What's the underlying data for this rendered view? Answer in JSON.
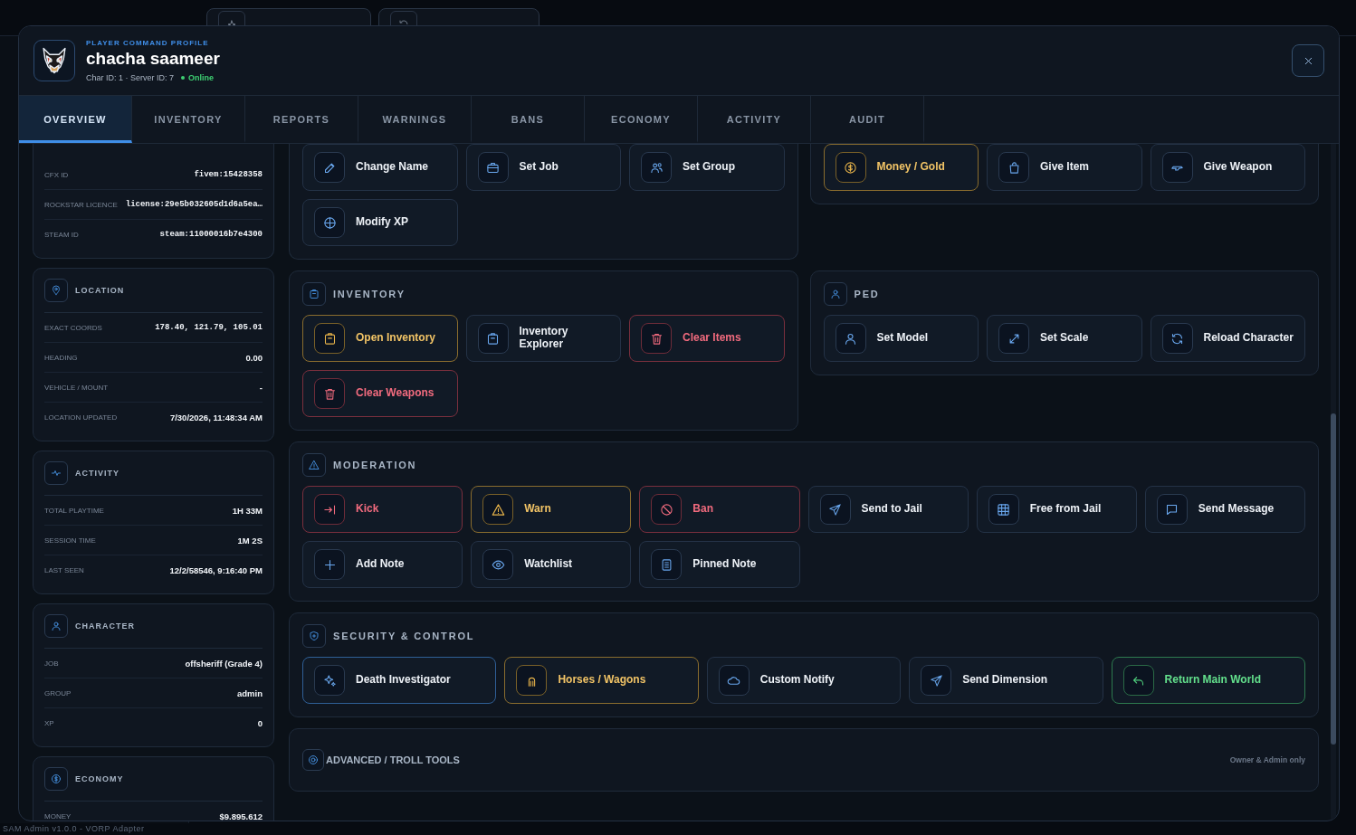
{
  "background": {
    "footer": "SAM Admin v1.0.0 - VORP Adapter"
  },
  "profile": {
    "eyebrow": "PLAYER COMMAND PROFILE",
    "name": "chacha saameer",
    "ids": "Char ID: 1 · Server ID: 7",
    "status": "Online"
  },
  "tabs": [
    {
      "label": "OVERVIEW",
      "selected": true
    },
    {
      "label": "INVENTORY",
      "selected": false
    },
    {
      "label": "REPORTS",
      "selected": false
    },
    {
      "label": "WARNINGS",
      "selected": false
    },
    {
      "label": "BANS",
      "selected": false
    },
    {
      "label": "ECONOMY",
      "selected": false
    },
    {
      "label": "ACTIVITY",
      "selected": false
    },
    {
      "label": "AUDIT",
      "selected": false
    }
  ],
  "identifiers": [
    {
      "label": "CFX ID",
      "value": "fivem:15428358"
    },
    {
      "label": "ROCKSTAR LICENCE",
      "value": "license:29e5b032605d1d6a5ea…"
    },
    {
      "label": "STEAM ID",
      "value": "steam:11000016b7e4300"
    }
  ],
  "info_cards": [
    {
      "title": "LOCATION",
      "rows": [
        {
          "label": "EXACT COORDS",
          "value": "178.40, 121.79, 105.01",
          "kind": "mono"
        },
        {
          "label": "HEADING",
          "value": "0.00",
          "kind": "text"
        },
        {
          "label": "VEHICLE / MOUNT",
          "value": "-",
          "kind": "text"
        },
        {
          "label": "LOCATION UPDATED",
          "value": "7/30/2026, 11:48:34 AM",
          "kind": "text"
        }
      ]
    },
    {
      "title": "ACTIVITY",
      "rows": [
        {
          "label": "TOTAL PLAYTIME",
          "value": "1H 33M",
          "kind": "text"
        },
        {
          "label": "SESSION TIME",
          "value": "1M 2S",
          "kind": "text"
        },
        {
          "label": "LAST SEEN",
          "value": "12/2/58546, 9:16:40 PM",
          "kind": "text"
        }
      ]
    },
    {
      "title": "CHARACTER",
      "rows": [
        {
          "label": "JOB",
          "value": "offsheriff (Grade 4)",
          "kind": "text"
        },
        {
          "label": "GROUP",
          "value": "admin",
          "kind": "text"
        },
        {
          "label": "XP",
          "value": "0",
          "kind": "text"
        }
      ]
    },
    {
      "title": "ECONOMY",
      "rows": [
        {
          "label": "MONEY",
          "value": "$9.895.612",
          "kind": "text"
        }
      ]
    }
  ],
  "action_sections": [
    {
      "buttons": [
        {
          "label": "Change Name",
          "kind": "default"
        },
        {
          "label": "Set Job",
          "kind": "default"
        },
        {
          "label": "Set Group",
          "kind": "default"
        },
        {
          "label": "Modify XP",
          "kind": "default"
        }
      ]
    },
    {
      "buttons": [
        {
          "label": "Money / Gold",
          "kind": "gold"
        },
        {
          "label": "Give Item",
          "kind": "default"
        },
        {
          "label": "Give Weapon",
          "kind": "default"
        }
      ]
    },
    {
      "title": "INVENTORY",
      "buttons": [
        {
          "label": "Open Inventory",
          "kind": "gold"
        },
        {
          "label": "Inventory Explorer",
          "kind": "default"
        },
        {
          "label": "Clear Items",
          "kind": "red"
        },
        {
          "label": "Clear Weapons",
          "kind": "red"
        }
      ]
    },
    {
      "title": "PED",
      "buttons": [
        {
          "label": "Set Model",
          "kind": "default"
        },
        {
          "label": "Set Scale",
          "kind": "default"
        },
        {
          "label": "Reload Character",
          "kind": "default"
        }
      ]
    },
    {
      "title": "MODERATION",
      "buttons": [
        {
          "label": "Kick",
          "kind": "red"
        },
        {
          "label": "Warn",
          "kind": "gold"
        },
        {
          "label": "Ban",
          "kind": "red"
        },
        {
          "label": "Send to Jail",
          "kind": "default"
        },
        {
          "label": "Free from Jail",
          "kind": "default"
        },
        {
          "label": "Send Message",
          "kind": "default"
        },
        {
          "label": "Add Note",
          "kind": "default"
        },
        {
          "label": "Watchlist",
          "kind": "default"
        },
        {
          "label": "Pinned Note",
          "kind": "default"
        }
      ]
    },
    {
      "title": "SECURITY & CONTROL",
      "buttons": [
        {
          "label": "Death Investigator",
          "kind": "blue"
        },
        {
          "label": "Horses / Wagons",
          "kind": "gold"
        },
        {
          "label": "Custom Notify",
          "kind": "default"
        },
        {
          "label": "Send Dimension",
          "kind": "default"
        },
        {
          "label": "Return Main World",
          "kind": "green"
        }
      ]
    }
  ],
  "advanced": {
    "title": "ADVANCED / TROLL TOOLS",
    "note": "Owner & Admin only"
  }
}
